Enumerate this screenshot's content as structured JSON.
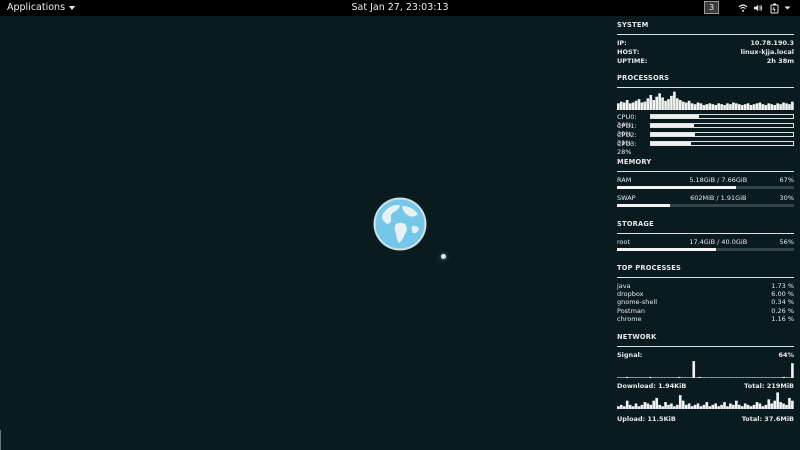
{
  "topbar": {
    "applications_label": "Applications",
    "clock": "Sat Jan 27, 23:03:13",
    "workspace_number": "3",
    "tray_icons": [
      "network-wireless-icon",
      "volume-icon",
      "power-icon",
      "system-menu-caret-icon"
    ]
  },
  "system": {
    "title": "SYSTEM",
    "ip_label": "IP:",
    "ip_value": "10.78.190.3",
    "host_label": "HOST:",
    "host_value": "linux-kjja.local",
    "uptime_label": "UPTIME:",
    "uptime_value": "2h 38m"
  },
  "processors": {
    "title": "PROCESSORS",
    "cpus": [
      {
        "label": "CPU0: 34%",
        "percent": 34
      },
      {
        "label": "CPU1: 30%",
        "percent": 30
      },
      {
        "label": "CPU2: 31%",
        "percent": 31
      },
      {
        "label": "CPU3: 28%",
        "percent": 28
      }
    ],
    "history": [
      8,
      10,
      9,
      12,
      8,
      9,
      11,
      13,
      9,
      10,
      14,
      18,
      12,
      16,
      20,
      15,
      11,
      13,
      17,
      22,
      14,
      12,
      10,
      9,
      11,
      8,
      7,
      9,
      8,
      6,
      7,
      8,
      7,
      6,
      8,
      7,
      6,
      8,
      7,
      9,
      8,
      7,
      6,
      7,
      8,
      6,
      7,
      8,
      9,
      7,
      6,
      8,
      7,
      6,
      8,
      7,
      9,
      8,
      7,
      10
    ]
  },
  "memory": {
    "title": "MEMORY",
    "ram_label": "RAM",
    "ram_value": "5.18GiB / 7.66GiB",
    "ram_percent_label": "67%",
    "ram_percent": 67,
    "swap_label": "SWAP",
    "swap_value": "602MiB / 1.91GiB",
    "swap_percent_label": "30%",
    "swap_percent": 30
  },
  "storage": {
    "title": "STORAGE",
    "root_label": "root",
    "root_value": "17.4GiB / 40.0GiB",
    "root_percent_label": "56%",
    "root_percent": 56
  },
  "top_processes": {
    "title": "TOP PROCESSES",
    "items": [
      {
        "name": "java",
        "value": "1.73 %"
      },
      {
        "name": "dropbox",
        "value": "6.00 %"
      },
      {
        "name": "gnome-shell",
        "value": "0.34 %"
      },
      {
        "name": "Postman",
        "value": "0.26 %"
      },
      {
        "name": "chrome",
        "value": "1.16 %"
      }
    ]
  },
  "network": {
    "title": "NETWORK",
    "signal_label": "Signal:",
    "signal_value": "64%",
    "download_label": "Download: 1.94KiB",
    "download_total": "Total: 219MiB",
    "upload_label": "Upload: 11.5KiB",
    "upload_total": "Total: 37.6MiB",
    "download_history": [
      0,
      0,
      0,
      1,
      0,
      0,
      0,
      0,
      0,
      0,
      0,
      1,
      0,
      0,
      0,
      0,
      0,
      0,
      0,
      0,
      0,
      1,
      0,
      0,
      0,
      0,
      16,
      0,
      1,
      0,
      0,
      0,
      0,
      0,
      0,
      0,
      0,
      0,
      0,
      0,
      0,
      0,
      0,
      0,
      0,
      0,
      0,
      0,
      0,
      0,
      0,
      0,
      0,
      0,
      0,
      0,
      0,
      1,
      0,
      0,
      14
    ],
    "upload_history": [
      2,
      3,
      2,
      6,
      3,
      2,
      4,
      2,
      3,
      5,
      4,
      3,
      6,
      8,
      3,
      2,
      5,
      3,
      4,
      2,
      3,
      10,
      6,
      3,
      4,
      2,
      3,
      4,
      2,
      3,
      5,
      2,
      3,
      4,
      2,
      3,
      5,
      2,
      4,
      3,
      6,
      3,
      2,
      4,
      3,
      2,
      3,
      5,
      4,
      2,
      3,
      7,
      4,
      6,
      12,
      5,
      4,
      3,
      8,
      6
    ]
  },
  "colors": {
    "background": "#0a1b20",
    "topbar": "#000000",
    "globe_ocean": "#74c7e8",
    "globe_land": "#e8f1f4",
    "text": "#e8e8e8"
  }
}
